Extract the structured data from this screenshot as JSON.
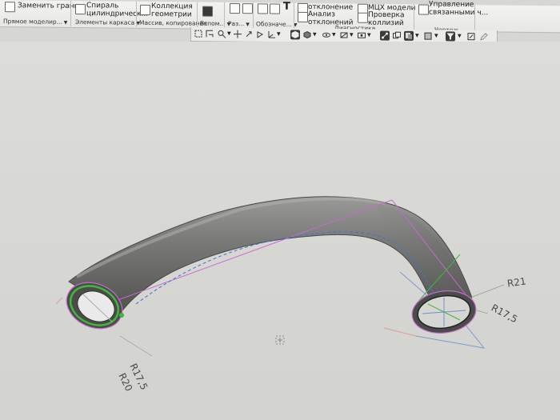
{
  "ribbon": {
    "replace_faces": "Заменить грани",
    "helix_line1": "Спираль",
    "helix_line2": "цилиндрическ...",
    "collection_line1": "Коллекция",
    "collection_line2": "геометрии",
    "deviation": "отклонение",
    "analysis_line1": "Анализ",
    "analysis_line2": "отклонений",
    "mcc": "МЦХ модели",
    "collision_line1": "Проверка",
    "collision_line2": "коллизий",
    "linked_line1": "Управление",
    "linked_line2": "связанными ч...",
    "groups": {
      "direct_edit": "Прямое моделир...",
      "frame": "Элементы каркаса",
      "array": "Массив, копирования",
      "aux": "Вспом...",
      "dim": "Раз...",
      "notation": "Обозначе...",
      "diagnostics": "Диагностика",
      "drawing": "Чертеж"
    }
  },
  "icons": {
    "view_toolbar": [
      "select-box-icon",
      "rotate-icon",
      "zoom-icon",
      "zoom-area-icon",
      "pan-icon",
      "orient-icon",
      "view-cube-icon",
      "shaded-icon",
      "hide-icon",
      "section-icon",
      "display-icon",
      "snap-icon",
      "windows-icon",
      "materials-icon",
      "filter-icon",
      "edit-icon",
      "pencil-icon"
    ]
  },
  "dimensions": {
    "right_outer": "R21",
    "right_inner": "R17,5",
    "left_outer": "R20",
    "left_inner": "R17,5"
  },
  "colors": {
    "background": "#d6d6d2",
    "tube": "#6f6f6d",
    "highlight_green": "#3db83a",
    "guide_pink": "#c86ad0",
    "guide_blue": "#4a6fd8"
  }
}
